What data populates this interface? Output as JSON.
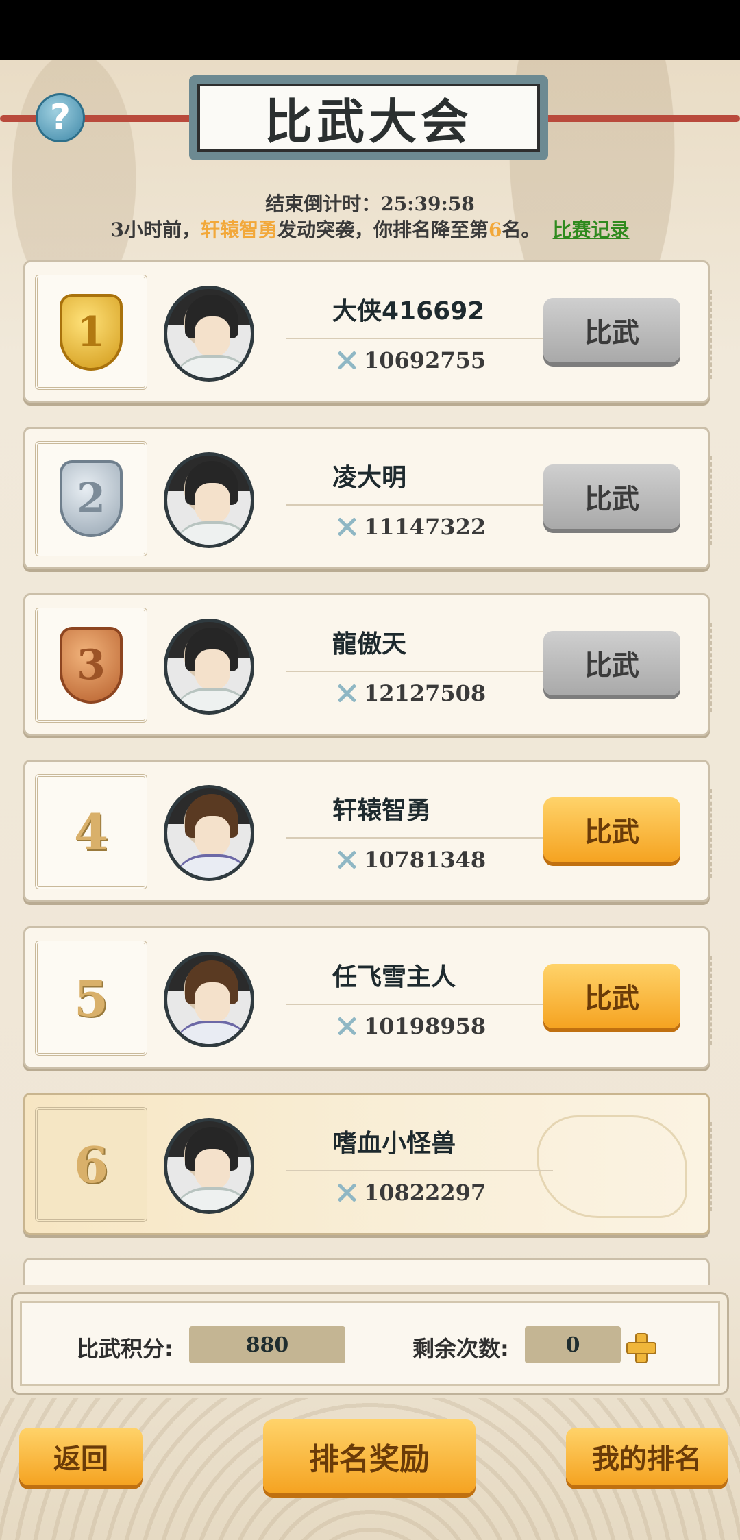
{
  "header": {
    "title": "比武大会",
    "help_icon": "?",
    "countdown_label": "结束倒计时：",
    "countdown_value": "25:39:58",
    "notice_prefix": "3小时前，",
    "notice_attacker": "轩辕智勇",
    "notice_middle": "发动突袭，你排名降至第",
    "notice_rank": "6",
    "notice_suffix": "名。",
    "record_link": "比赛记录"
  },
  "colors": {
    "highlight": "#f2a83a",
    "link": "#2f8a1e",
    "button_orange": "#f5a321",
    "button_gray": "#a9a9a9"
  },
  "players": [
    {
      "rank": "1",
      "medal": "gold",
      "name": "大侠416692",
      "power": "10692755",
      "button": "比武",
      "button_state": "disabled"
    },
    {
      "rank": "2",
      "medal": "silver",
      "name": "凌大明",
      "power": "11147322",
      "button": "比武",
      "button_state": "disabled"
    },
    {
      "rank": "3",
      "medal": "bronze",
      "name": "龍傲天",
      "power": "12127508",
      "button": "比武",
      "button_state": "disabled"
    },
    {
      "rank": "4",
      "medal": "",
      "name": "轩辕智勇",
      "power": "10781348",
      "button": "比武",
      "button_state": "active"
    },
    {
      "rank": "5",
      "medal": "",
      "name": "任飞雪主人",
      "power": "10198958",
      "button": "比武",
      "button_state": "active"
    },
    {
      "rank": "6",
      "medal": "",
      "name": "嗜血小怪兽",
      "power": "10822297",
      "button": "",
      "button_state": "self"
    }
  ],
  "score_panel": {
    "points_label": "比武积分:",
    "points_value": "880",
    "remaining_label": "剩余次数:",
    "remaining_value": "0"
  },
  "footer": {
    "back": "返回",
    "rewards": "排名奖励",
    "my_rank": "我的排名"
  }
}
